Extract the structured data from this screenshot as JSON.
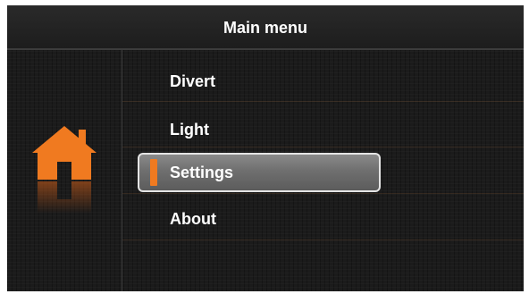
{
  "header": {
    "title": "Main menu"
  },
  "sidebar": {
    "icon": "home-icon",
    "icon_color": "#f07a20"
  },
  "menu": {
    "items": [
      {
        "label": "Divert",
        "selected": false
      },
      {
        "label": "Light",
        "selected": false
      },
      {
        "label": "Settings",
        "selected": true
      },
      {
        "label": "About",
        "selected": false
      }
    ],
    "selection_color": "#f07a20"
  }
}
